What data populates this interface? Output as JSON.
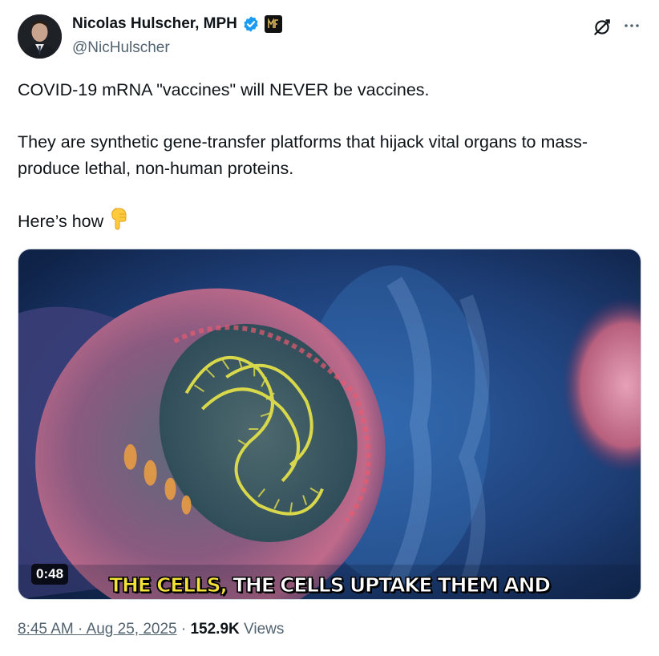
{
  "author": {
    "display_name": "Nicolas Hulscher, MPH",
    "handle": "@NicHulscher",
    "verified": true,
    "affiliate_badge": "MF"
  },
  "tweet": {
    "paragraphs": [
      "COVID-19 mRNA \"vaccines\" will NEVER be vaccines.",
      "They are synthetic gene-transfer platforms that hijack vital organs to mass-produce lethal, non-human proteins.",
      "Here’s how"
    ],
    "emoji": "backhand-index-pointing-down"
  },
  "media": {
    "duration": "0:48",
    "caption_highlight": "THE CELLS,",
    "caption_rest": "THE CELLS UPTAKE THEM AND"
  },
  "meta": {
    "timestamp": "8:45 AM · Aug 25, 2025",
    "separator": "·",
    "views_count": "152.9K",
    "views_label": "Views"
  },
  "colors": {
    "verified_blue": "#1d9bf0",
    "secondary_text": "#536471",
    "caption_highlight": "#f4e23a"
  }
}
